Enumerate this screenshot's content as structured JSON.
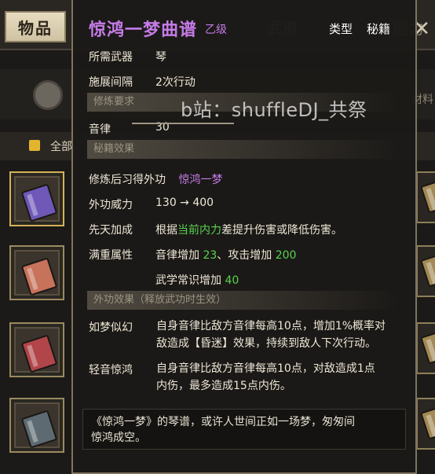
{
  "background": {
    "tab_items": "物品",
    "tab_weapons": "武道",
    "tab_abilities": "能力",
    "close_glyph": "✕",
    "filter_all": "全部",
    "side_text": "材料"
  },
  "tooltip": {
    "title": "惊鸿一梦曲谱",
    "grade": "乙级",
    "type_label": "类型",
    "type_value": "秘籍",
    "required_weapon_label": "所需武器",
    "required_weapon_value": "琴",
    "cast_interval_label": "施展间隔",
    "cast_interval_value": "2次行动",
    "section_requirements": "修炼要求",
    "music_label": "音律",
    "music_value": "30",
    "section_effects": "秘籍效果",
    "learn_label": "修炼后习得外功",
    "learn_value": "惊鸿一梦",
    "power_label": "外功威力",
    "power_value": "130 → 400",
    "innate_label": "先天加成",
    "innate_pre": "根据",
    "innate_highlight": "当前内力",
    "innate_post": "差提升伤害或降低伤害。",
    "full_bonus_label": "满重属性",
    "full_bonus_1_pre": "音律增加 ",
    "full_bonus_1_val": "23",
    "full_bonus_1_mid": "、攻击增加 ",
    "full_bonus_1_val2": "200",
    "full_bonus_2_pre": "武学常识增加 ",
    "full_bonus_2_val": "40",
    "section_skill": "外功效果（释放武功时生效）",
    "effect1_name": "如梦似幻",
    "effect1_line1": "自身音律比敌方音律每高10点，增加1%概率对",
    "effect1_line2": "敌造成【昏迷】效果，持续到敌人下次行动。",
    "effect2_name": "轻音惊鸿",
    "effect2_line1": "自身音律比敌方音律每高10点，对敌造成1点",
    "effect2_line2": "内伤，最多造成15点内伤。",
    "flavor_line1": "《惊鸿一梦》的琴谱，或许人世间正如一场梦，匆匆间",
    "flavor_line2": "惊鸿成空。"
  },
  "watermark": "b站：shuffleDJ_共祭",
  "colors": {
    "title_purple": "#c57be8",
    "highlight_green": "#59d34f",
    "panel_bg": "#1c1a17",
    "border": "#7f745f"
  }
}
